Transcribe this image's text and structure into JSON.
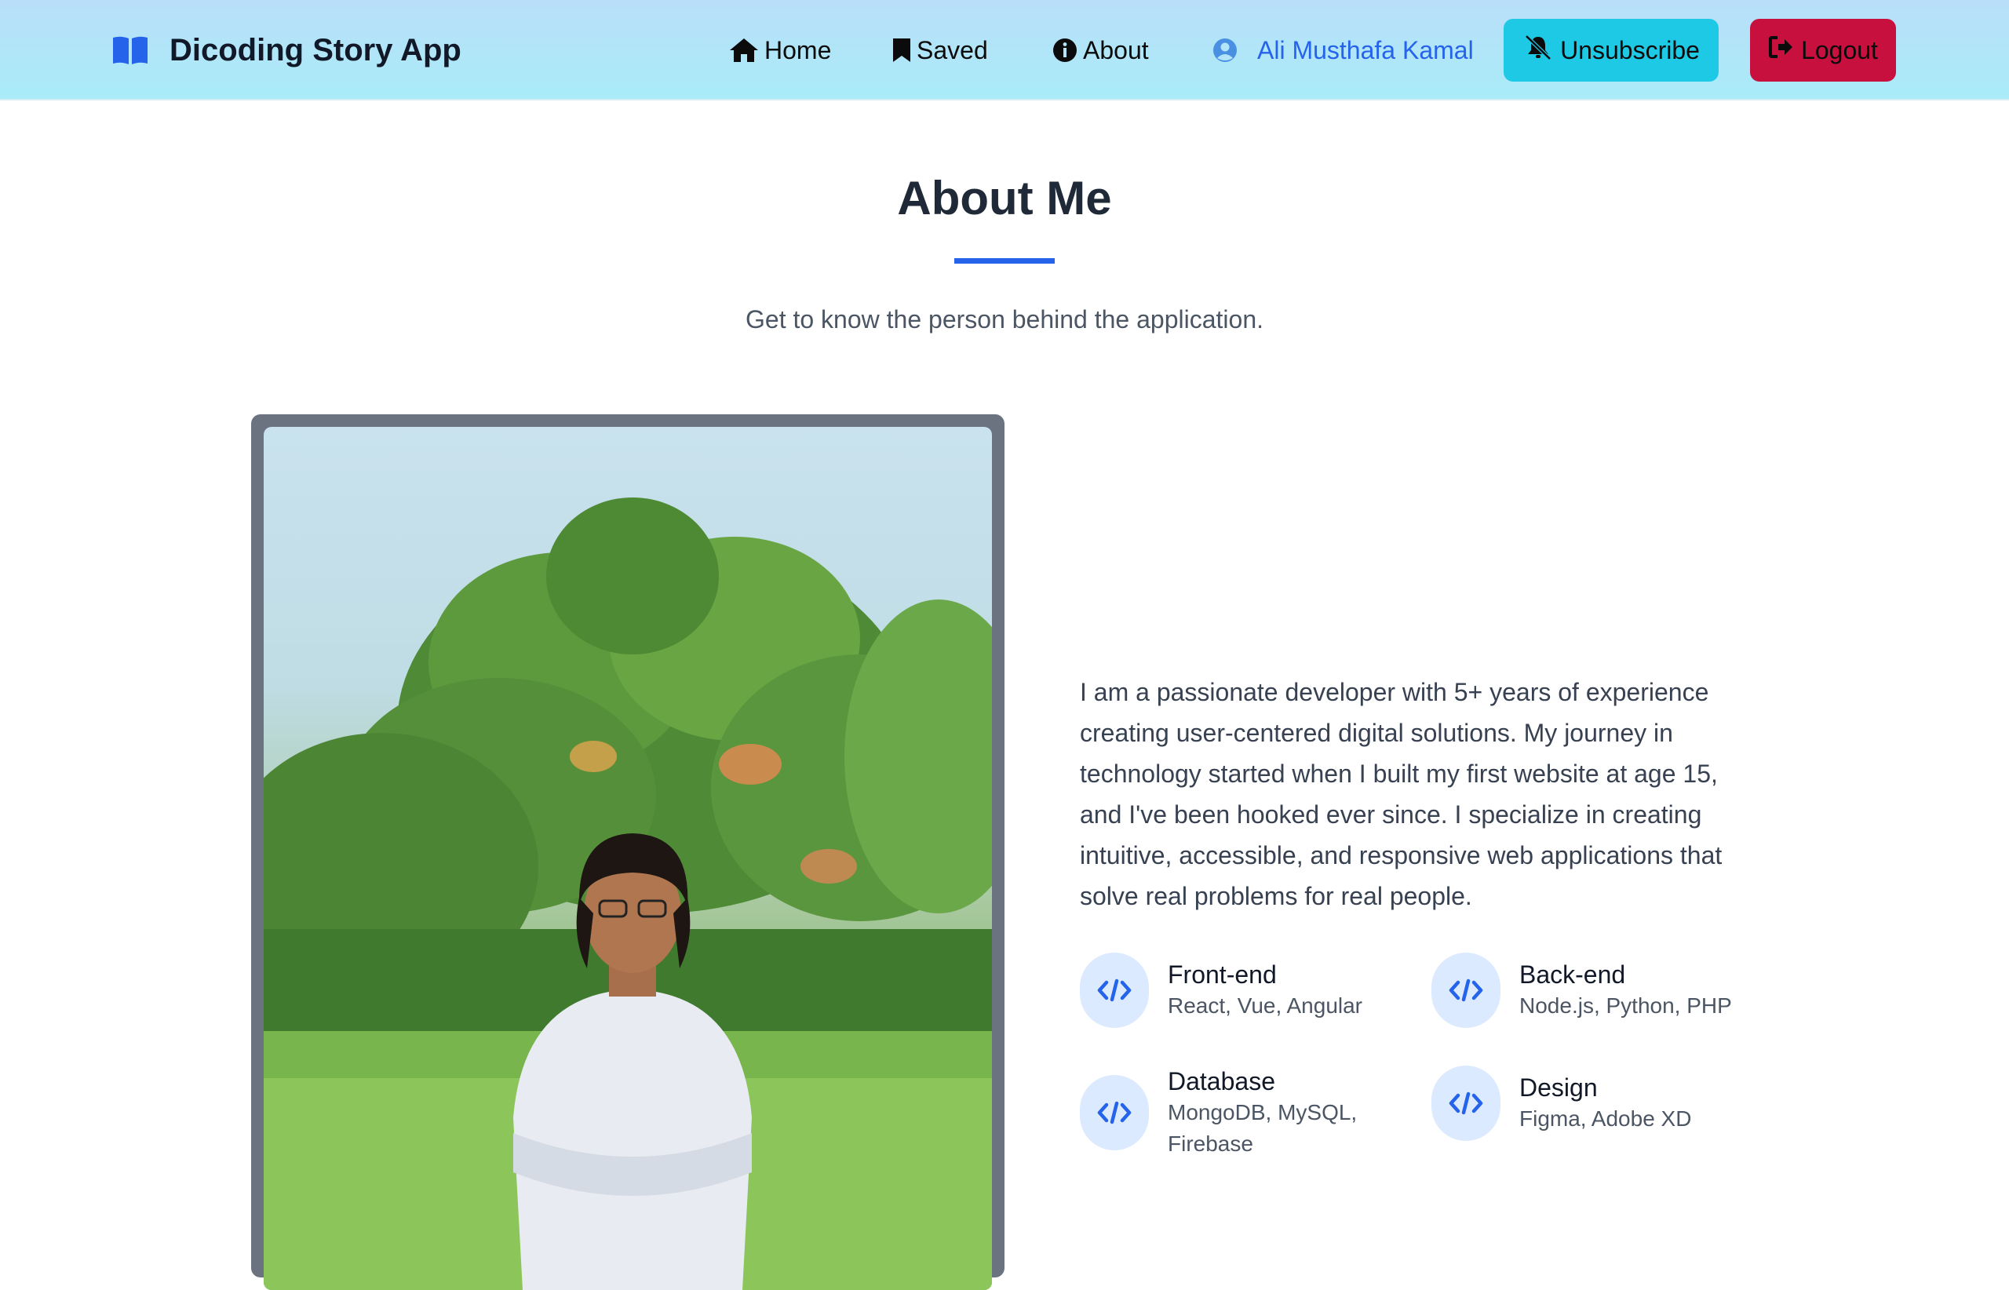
{
  "navbar": {
    "brand": "Dicoding Story App",
    "items": [
      {
        "label": "Home",
        "icon": "home-icon"
      },
      {
        "label": "Saved",
        "icon": "bookmark-icon"
      },
      {
        "label": "About",
        "icon": "info-icon"
      }
    ],
    "user_name": "Ali Musthafa Kamal",
    "unsubscribe_label": "Unsubscribe",
    "logout_label": "Logout"
  },
  "about": {
    "title": "About Me",
    "subtitle": "Get to know the person behind the application.",
    "bio": "I am a passionate developer with 5+ years of experience creating user-centered digital solutions. My journey in technology started when I built my first website at age 15, and I've been hooked ever since. I specialize in creating intuitive, accessible, and responsive web applications that solve real problems for real people.",
    "skills": [
      {
        "name": "Front-end",
        "desc": "React, Vue, Angular",
        "icon": "code-icon"
      },
      {
        "name": "Back-end",
        "desc": "Node.js, Python, PHP",
        "icon": "code-icon"
      },
      {
        "name": "Database",
        "desc": "MongoDB, MySQL, Firebase",
        "icon": "code-icon"
      },
      {
        "name": "Design",
        "desc": "Figma, Adobe XD",
        "icon": "code-icon"
      }
    ]
  },
  "colors": {
    "accent": "#2563eb",
    "unsubscribe": "#1ec9e6",
    "logout": "#c8103e"
  }
}
